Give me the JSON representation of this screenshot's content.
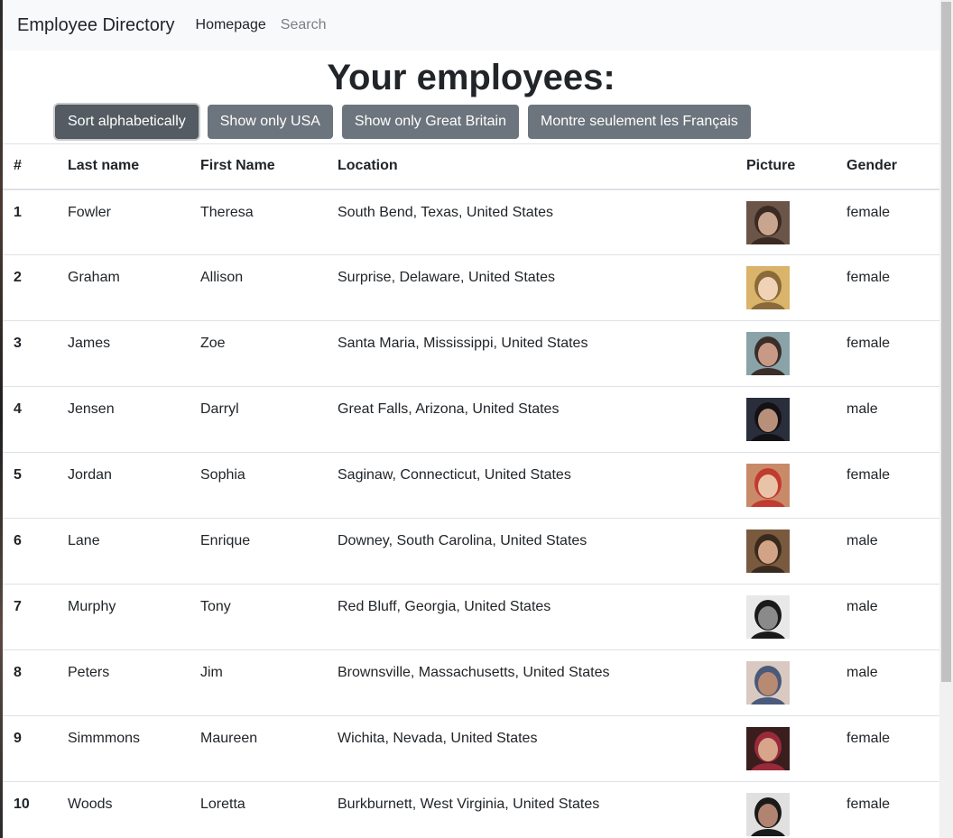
{
  "navbar": {
    "brand": "Employee Directory",
    "home_link": "Homepage",
    "search_label": "Search"
  },
  "heading": "Your employees:",
  "buttons": {
    "sort": "Sort alphabetically",
    "usa": "Show only USA",
    "gb": "Show only Great Britain",
    "fr": "Montre seulement les Français"
  },
  "table": {
    "headers": {
      "num": "#",
      "last": "Last name",
      "first": "First Name",
      "location": "Location",
      "picture": "Picture",
      "gender": "Gender"
    },
    "rows": [
      {
        "num": "1",
        "last": "Fowler",
        "first": "Theresa",
        "location": "South Bend, Texas, United States",
        "gender": "female",
        "avatar_colors": [
          "#6b5548",
          "#c9a48e",
          "#3b2a22"
        ]
      },
      {
        "num": "2",
        "last": "Graham",
        "first": "Allison",
        "location": "Surprise, Delaware, United States",
        "gender": "female",
        "avatar_colors": [
          "#d9b46a",
          "#f0d3b6",
          "#8a6a3a"
        ]
      },
      {
        "num": "3",
        "last": "James",
        "first": "Zoe",
        "location": "Santa Maria, Mississippi, United States",
        "gender": "female",
        "avatar_colors": [
          "#8aa3a8",
          "#c89a86",
          "#3a2e2a"
        ]
      },
      {
        "num": "4",
        "last": "Jensen",
        "first": "Darryl",
        "location": "Great Falls, Arizona, United States",
        "gender": "male",
        "avatar_colors": [
          "#2a2d3a",
          "#b8907a",
          "#121216"
        ]
      },
      {
        "num": "5",
        "last": "Jordan",
        "first": "Sophia",
        "location": "Saginaw, Connecticut, United States",
        "gender": "female",
        "avatar_colors": [
          "#c98a6a",
          "#e9c3a8",
          "#c23b2f"
        ]
      },
      {
        "num": "6",
        "last": "Lane",
        "first": "Enrique",
        "location": "Downey, South Carolina, United States",
        "gender": "male",
        "avatar_colors": [
          "#7a5a3e",
          "#d2a384",
          "#3a2a1e"
        ]
      },
      {
        "num": "7",
        "last": "Murphy",
        "first": "Tony",
        "location": "Red Bluff, Georgia, United States",
        "gender": "male",
        "avatar_colors": [
          "#e8e8e8",
          "#8a8a8a",
          "#1a1a1a"
        ]
      },
      {
        "num": "8",
        "last": "Peters",
        "first": "Jim",
        "location": "Brownsville, Massachusetts, United States",
        "gender": "male",
        "avatar_colors": [
          "#d9c9c0",
          "#b88a72",
          "#4a5a7a"
        ]
      },
      {
        "num": "9",
        "last": "Simmmons",
        "first": "Maureen",
        "location": "Wichita, Nevada, United States",
        "gender": "female",
        "avatar_colors": [
          "#3a1e1e",
          "#d8a48a",
          "#9a2a3a"
        ]
      },
      {
        "num": "10",
        "last": "Woods",
        "first": "Loretta",
        "location": "Burkburnett, West Virginia, United States",
        "gender": "female",
        "avatar_colors": [
          "#e0e0e0",
          "#b08470",
          "#1a1a1a"
        ]
      }
    ]
  }
}
